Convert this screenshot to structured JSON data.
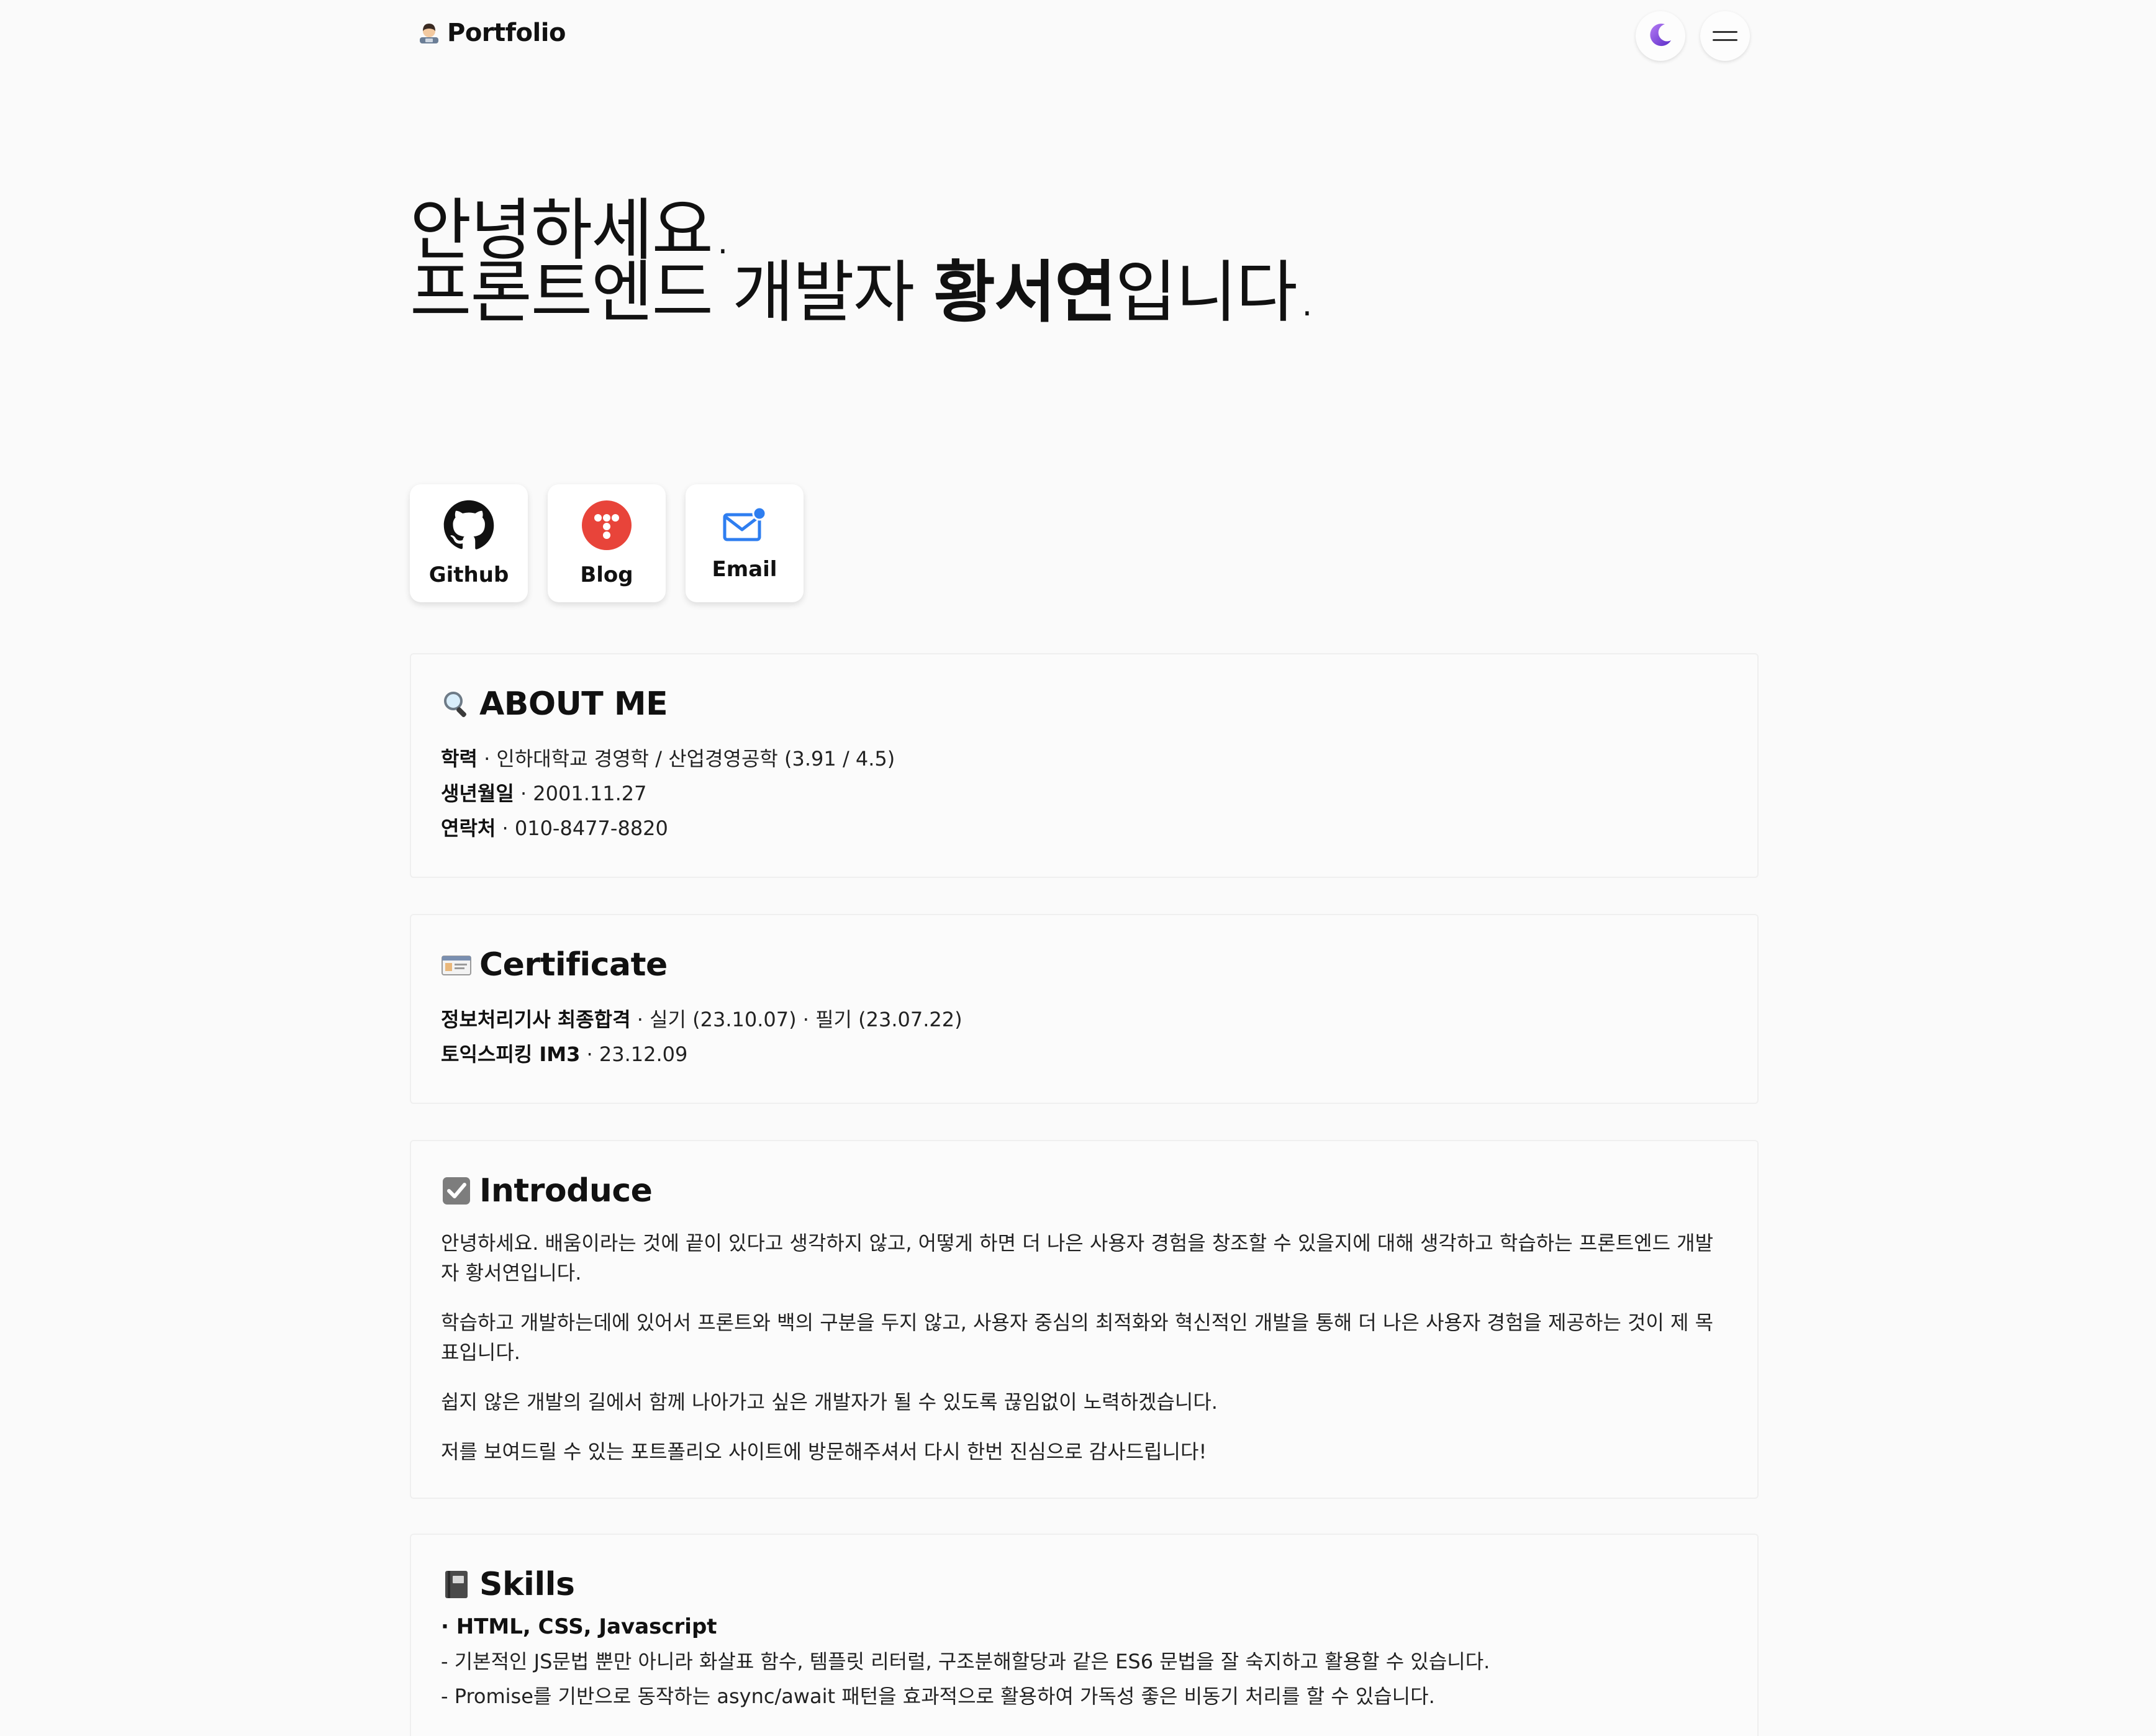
{
  "header": {
    "brand_text": "Portfolio",
    "avatar_icon": "woman-technologist-icon",
    "theme_icon": "moon-icon",
    "menu_icon": "hamburger-menu-icon"
  },
  "hero": {
    "line1": "안녕하세요.",
    "line2_prefix": "프론트엔드 개발자 ",
    "name": "황서연",
    "line2_suffix": "입니다."
  },
  "social": [
    {
      "label": "Github",
      "icon": "github-icon"
    },
    {
      "label": "Blog",
      "icon": "tistory-icon"
    },
    {
      "label": "Email",
      "icon": "mail-icon"
    }
  ],
  "about": {
    "icon": "magnifier-icon",
    "title": "ABOUT ME",
    "rows": [
      {
        "key": "학력",
        "value": "인하대학교 경영학 / 산업경영공학 (3.91 / 4.5)"
      },
      {
        "key": "생년월일",
        "value": "2001.11.27"
      },
      {
        "key": "연락처",
        "value": "010-8477-8820"
      }
    ]
  },
  "certificate": {
    "icon": "id-card-icon",
    "title": "Certificate",
    "rows": [
      {
        "key": "정보처리기사 최종합격",
        "value": "실기 (23.10.07) · 필기 (23.07.22)"
      },
      {
        "key": "토익스피킹 IM3",
        "value": "23.12.09"
      }
    ]
  },
  "introduce": {
    "icon": "check-box-icon",
    "title": "Introduce",
    "paragraphs": [
      "안녕하세요. 배움이라는 것에 끝이 있다고 생각하지 않고, 어떻게 하면 더 나은 사용자 경험을 창조할 수 있을지에 대해 생각하고 학습하는 프론트엔드 개발자 황서연입니다.",
      "학습하고 개발하는데에 있어서 프론트와 백의 구분을 두지 않고, 사용자 중심의 최적화와 혁신적인 개발을 통해 더 나은 사용자 경험을 제공하는 것이 제 목표입니다.",
      "쉽지 않은 개발의 길에서 함께 나아가고 싶은 개발자가 될 수 있도록 끊임없이 노력하겠습니다.",
      "저를 보여드릴 수 있는 포트폴리오 사이트에 방문해주셔서 다시 한번 진심으로 감사드립니다!"
    ]
  },
  "skills": {
    "icon": "notebook-icon",
    "title": "Skills",
    "group_title": "· HTML, CSS, Javascript",
    "lines": [
      "- 기본적인 JS문법 뿐만 아니라 화살표 함수, 템플릿 리터럴, 구조분해할당과 같은 ES6 문법을 잘 숙지하고 활용할 수 있습니다.",
      "- Promise를 기반으로 동작하는 async/await 패턴을 효과적으로 활용하여 가독성 좋은 비동기 처리를 할 수 있습니다."
    ]
  },
  "colors": {
    "background": "#fafafa",
    "card": "#ffffff",
    "blog_red": "#e8443a",
    "mail_blue": "#2e7ef0",
    "moon_purple": "#7b3fe4"
  }
}
